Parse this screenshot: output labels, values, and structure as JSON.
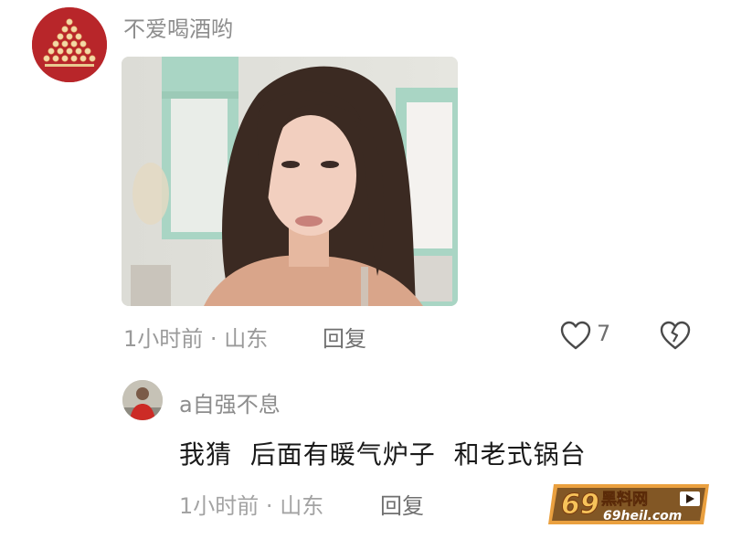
{
  "comment": {
    "username": "不爱喝酒哟",
    "time": "1小时前",
    "separator": "·",
    "location": "山东",
    "reply_label": "回复",
    "likes": "7",
    "avatar_icon": "wine-cups-pyramid-avatar",
    "image_icon": "woman-selfie-photo"
  },
  "reply": {
    "username": "a自强不息",
    "text": "我猜  后面有暖气炉子  和老式锅台",
    "time": "1小时前",
    "separator": "·",
    "location": "山东",
    "reply_label": "回复",
    "avatar_icon": "person-avatar"
  },
  "watermark": {
    "number": "69",
    "brand": "黑料网",
    "domain": "69heil.com"
  },
  "colors": {
    "avatar_red": "#b8262a",
    "muted_text": "#9a9a9a",
    "body_text": "#1a1a1a",
    "watermark_orange": "#e8962a"
  }
}
